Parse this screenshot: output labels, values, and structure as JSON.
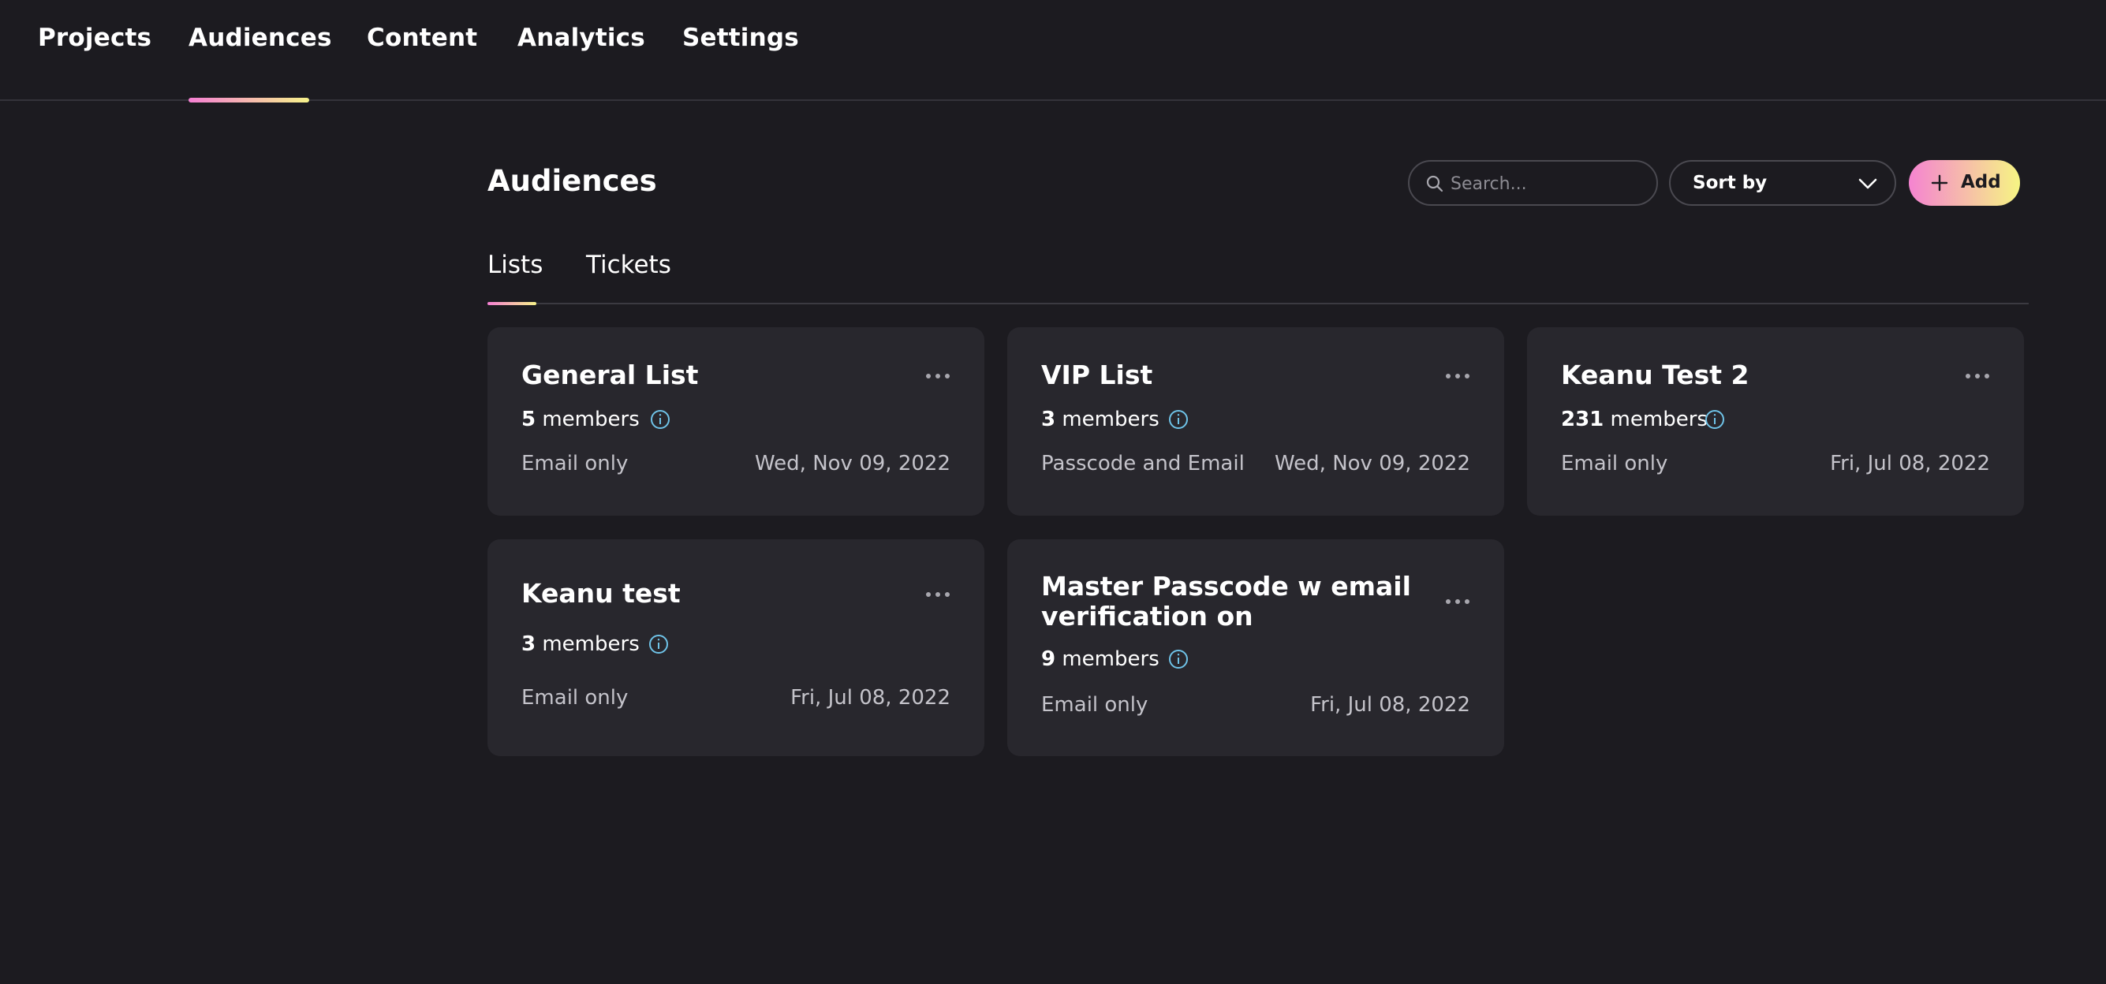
{
  "nav": {
    "items": [
      {
        "label": "Projects"
      },
      {
        "label": "Audiences"
      },
      {
        "label": "Content"
      },
      {
        "label": "Analytics"
      },
      {
        "label": "Settings"
      }
    ],
    "active": "Audiences"
  },
  "page": {
    "title": "Audiences"
  },
  "search": {
    "placeholder": "Search...",
    "value": ""
  },
  "sort": {
    "label": "Sort by"
  },
  "add_button": {
    "label": "Add"
  },
  "tabs": [
    {
      "label": "Lists",
      "active": true
    },
    {
      "label": "Tickets",
      "active": false
    }
  ],
  "cards": [
    {
      "title": "General List",
      "member_count": "5",
      "member_word": "members",
      "access": "Email only",
      "date": "Wed, Nov 09, 2022"
    },
    {
      "title": "VIP List",
      "member_count": "3",
      "member_word": "members",
      "access": "Passcode and Email",
      "date": "Wed, Nov 09, 2022"
    },
    {
      "title": "Keanu Test 2",
      "member_count": "231",
      "member_word": "members",
      "access": "Email only",
      "date": "Fri, Jul 08, 2022"
    },
    {
      "title": "Keanu test",
      "member_count": "3",
      "member_word": "members",
      "access": "Email only",
      "date": "Fri, Jul 08, 2022"
    },
    {
      "title": "Master Passcode w email verification on",
      "member_count": "9",
      "member_word": "members",
      "access": "Email only",
      "date": "Fri, Jul 08, 2022"
    }
  ],
  "colors": {
    "background": "#1c1b20",
    "card": "#28272d",
    "accent_gradient_start": "#f57fd3",
    "accent_gradient_end": "#f6f28a",
    "info_icon": "#6fc3e8"
  },
  "icons": {
    "search": "search-icon",
    "sort": "chevron-down-icon",
    "add": "plus-icon",
    "card_menu": "more-horizontal-icon",
    "info": "info-icon"
  }
}
